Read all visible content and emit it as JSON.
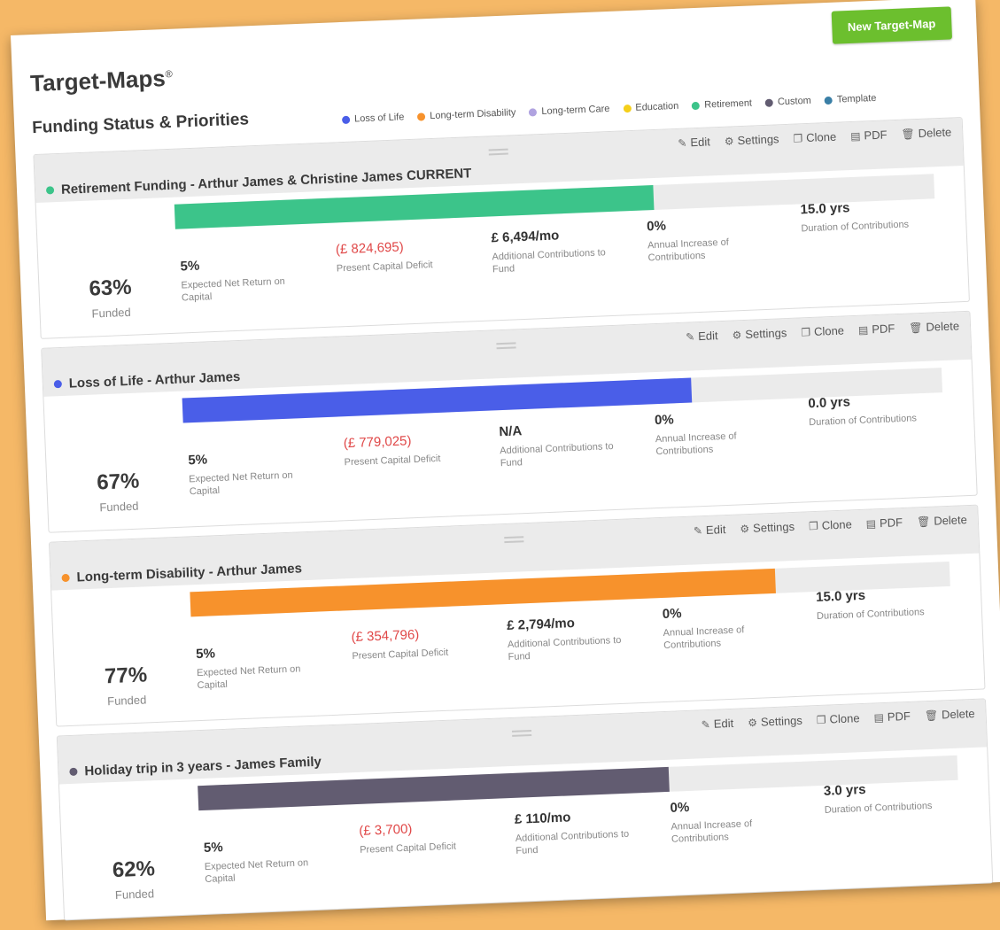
{
  "header": {
    "title": "Target-Maps",
    "title_mark": "®",
    "new_button": "New Target-Map",
    "section_title": "Funding Status & Priorities"
  },
  "legend": [
    {
      "label": "Loss of Life",
      "color": "#4a5ee8"
    },
    {
      "label": "Long-term Disability",
      "color": "#f7922c"
    },
    {
      "label": "Long-term Care",
      "color": "#b0a3e0"
    },
    {
      "label": "Education",
      "color": "#f5cf1a"
    },
    {
      "label": "Retirement",
      "color": "#3cc48a"
    },
    {
      "label": "Custom",
      "color": "#625c71"
    },
    {
      "label": "Template",
      "color": "#3a7fa6"
    }
  ],
  "actions": {
    "edit": "Edit",
    "settings": "Settings",
    "clone": "Clone",
    "pdf": "PDF",
    "delete": "Delete"
  },
  "labels": {
    "funded": "Funded",
    "return": "Expected Net Return on Capital",
    "deficit": "Present Capital Deficit",
    "contributions": "Additional Contributions to Fund",
    "increase": "Annual Increase of Contributions",
    "duration": "Duration of Contributions"
  },
  "cards": [
    {
      "title": "Retirement Funding - Arthur James & Christine James CURRENT",
      "color": "#3cc48a",
      "progress": 0.63,
      "funded": "63%",
      "return": "5%",
      "deficit": "(£ 824,695)",
      "contributions": "£ 6,494/mo",
      "increase": "0%",
      "duration": "15.0 yrs"
    },
    {
      "title": "Loss of Life - Arthur James",
      "color": "#4a5ee8",
      "progress": 0.67,
      "funded": "67%",
      "return": "5%",
      "deficit": "(£ 779,025)",
      "contributions": "N/A",
      "increase": "0%",
      "duration": "0.0 yrs"
    },
    {
      "title": "Long-term Disability - Arthur James",
      "color": "#f7922c",
      "progress": 0.77,
      "funded": "77%",
      "return": "5%",
      "deficit": "(£ 354,796)",
      "contributions": "£ 2,794/mo",
      "increase": "0%",
      "duration": "15.0 yrs"
    },
    {
      "title": "Holiday trip in 3 years - James Family",
      "color": "#625c71",
      "progress": 0.62,
      "funded": "62%",
      "return": "5%",
      "deficit": "(£ 3,700)",
      "contributions": "£ 110/mo",
      "increase": "0%",
      "duration": "3.0 yrs"
    }
  ]
}
